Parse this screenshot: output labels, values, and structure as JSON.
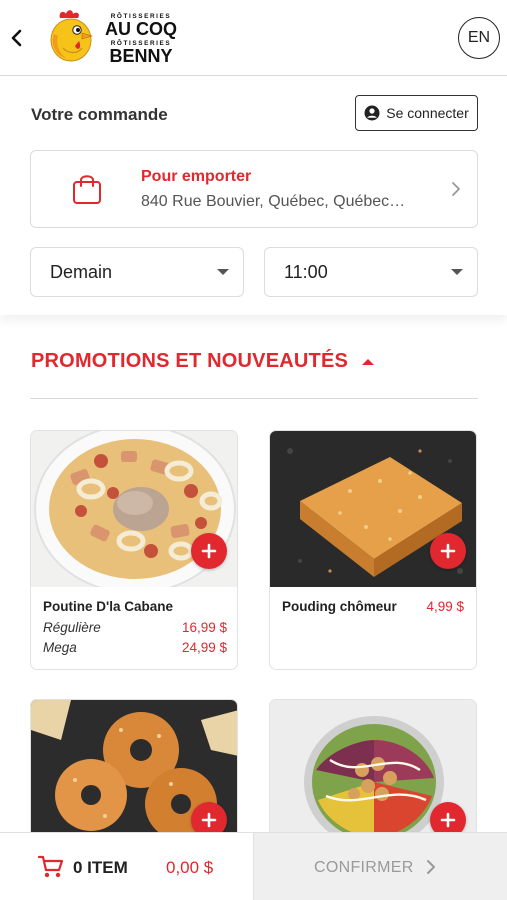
{
  "header": {
    "brand_line1": "RÔTISSERIES",
    "brand_name1": "AU COQ",
    "brand_line2": "RÔTISSERIES",
    "brand_name2": "BENNY",
    "language_button": "EN"
  },
  "order": {
    "title": "Votre commande",
    "login_label": "Se connecter",
    "pickup_title": "Pour emporter",
    "pickup_address": "840 Rue Bouvier, Québec, Québec…",
    "day_value": "Demain",
    "time_value": "11:00"
  },
  "section": {
    "title": "PROMOTIONS ET NOUVEAUTÉS"
  },
  "products": [
    {
      "name": "Poutine D'la Cabane",
      "options": [
        {
          "label": "Régulière",
          "price": "16,99 $"
        },
        {
          "label": "Mega",
          "price": "24,99 $"
        }
      ]
    },
    {
      "name": "Pouding chômeur",
      "price": "4,99 $"
    }
  ],
  "cart": {
    "count_label": "0 ITEM",
    "total": "0,00 $",
    "confirm_label": "CONFIRMER"
  },
  "colors": {
    "accent": "#e0282e",
    "text": "#222222",
    "muted": "#9a9a9a"
  }
}
